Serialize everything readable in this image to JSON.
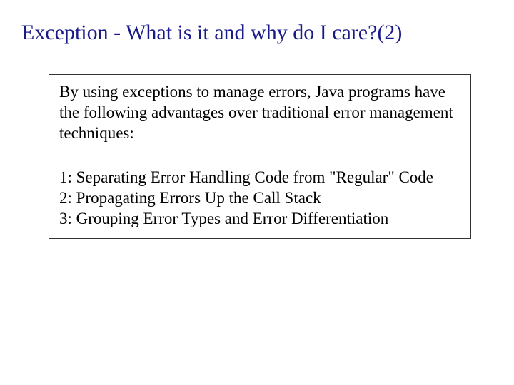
{
  "title": "Exception - What is it and why do I care?(2)",
  "intro": "By using exceptions to manage errors, Java programs have the following advantages over traditional error management techniques:",
  "item1": "1: Separating Error Handling Code from \"Regular\" Code",
  "item2": "2: Propagating Errors Up the Call Stack",
  "item3": "3: Grouping Error Types and Error Differentiation"
}
